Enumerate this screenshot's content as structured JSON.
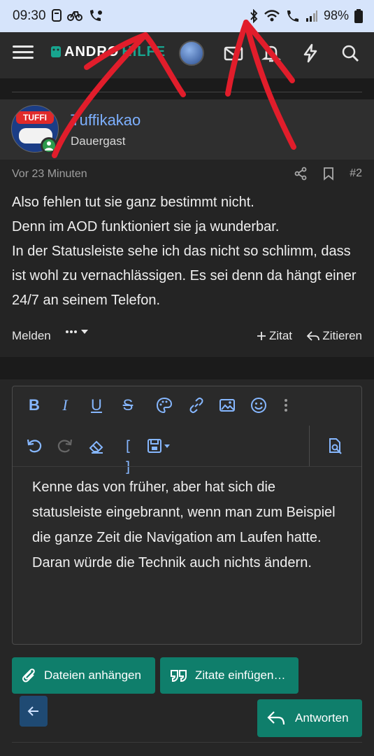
{
  "status_bar": {
    "time": "09:30",
    "battery": "98%",
    "icons_left": [
      "notification-icon",
      "bike-icon",
      "wifi-call-icon"
    ],
    "icons_right": [
      "bluetooth-icon",
      "wifi-icon",
      "call-icon",
      "signal-icon",
      "battery-icon"
    ]
  },
  "header": {
    "logo_text_a": "ANDRO",
    "logo_text_b": "HILFE",
    "icons": [
      "menu-icon",
      "avatar",
      "mail-icon",
      "bell-icon",
      "lightning-icon",
      "search-icon"
    ]
  },
  "post": {
    "author": "Tuffikakao",
    "author_title": "Dauergast",
    "time": "Vor 23 Minuten",
    "number": "#2",
    "avatar_text": "TUFFI",
    "lines": [
      "Also fehlen tut sie ganz bestimmt nicht.",
      "Denn im AOD funktioniert sie ja wunderbar.",
      "In der Statusleiste sehe ich das nicht so schlimm, dass ist wohl zu vernachlässigen. Es sei denn da hängt einer 24/7 an seinem Telefon."
    ],
    "report_label": "Melden",
    "quote_label": "Zitat",
    "reply_label": "Zitieren"
  },
  "editor": {
    "lines": [
      "Kenne das von früher, aber hat sich die statusleiste eingebrannt, wenn man zum Beispiel die ganze Zeit die Navigation am Laufen hatte.",
      "Daran würde die Technik auch nichts ändern."
    ],
    "attach_label": "Dateien anhängen",
    "insert_quotes_label": "Zitate einfügen…",
    "submit_label": "Antworten"
  },
  "colors": {
    "accent_green": "#0f7e6b",
    "link_blue": "#7db0ff",
    "annotation_red": "#e11d2b"
  }
}
